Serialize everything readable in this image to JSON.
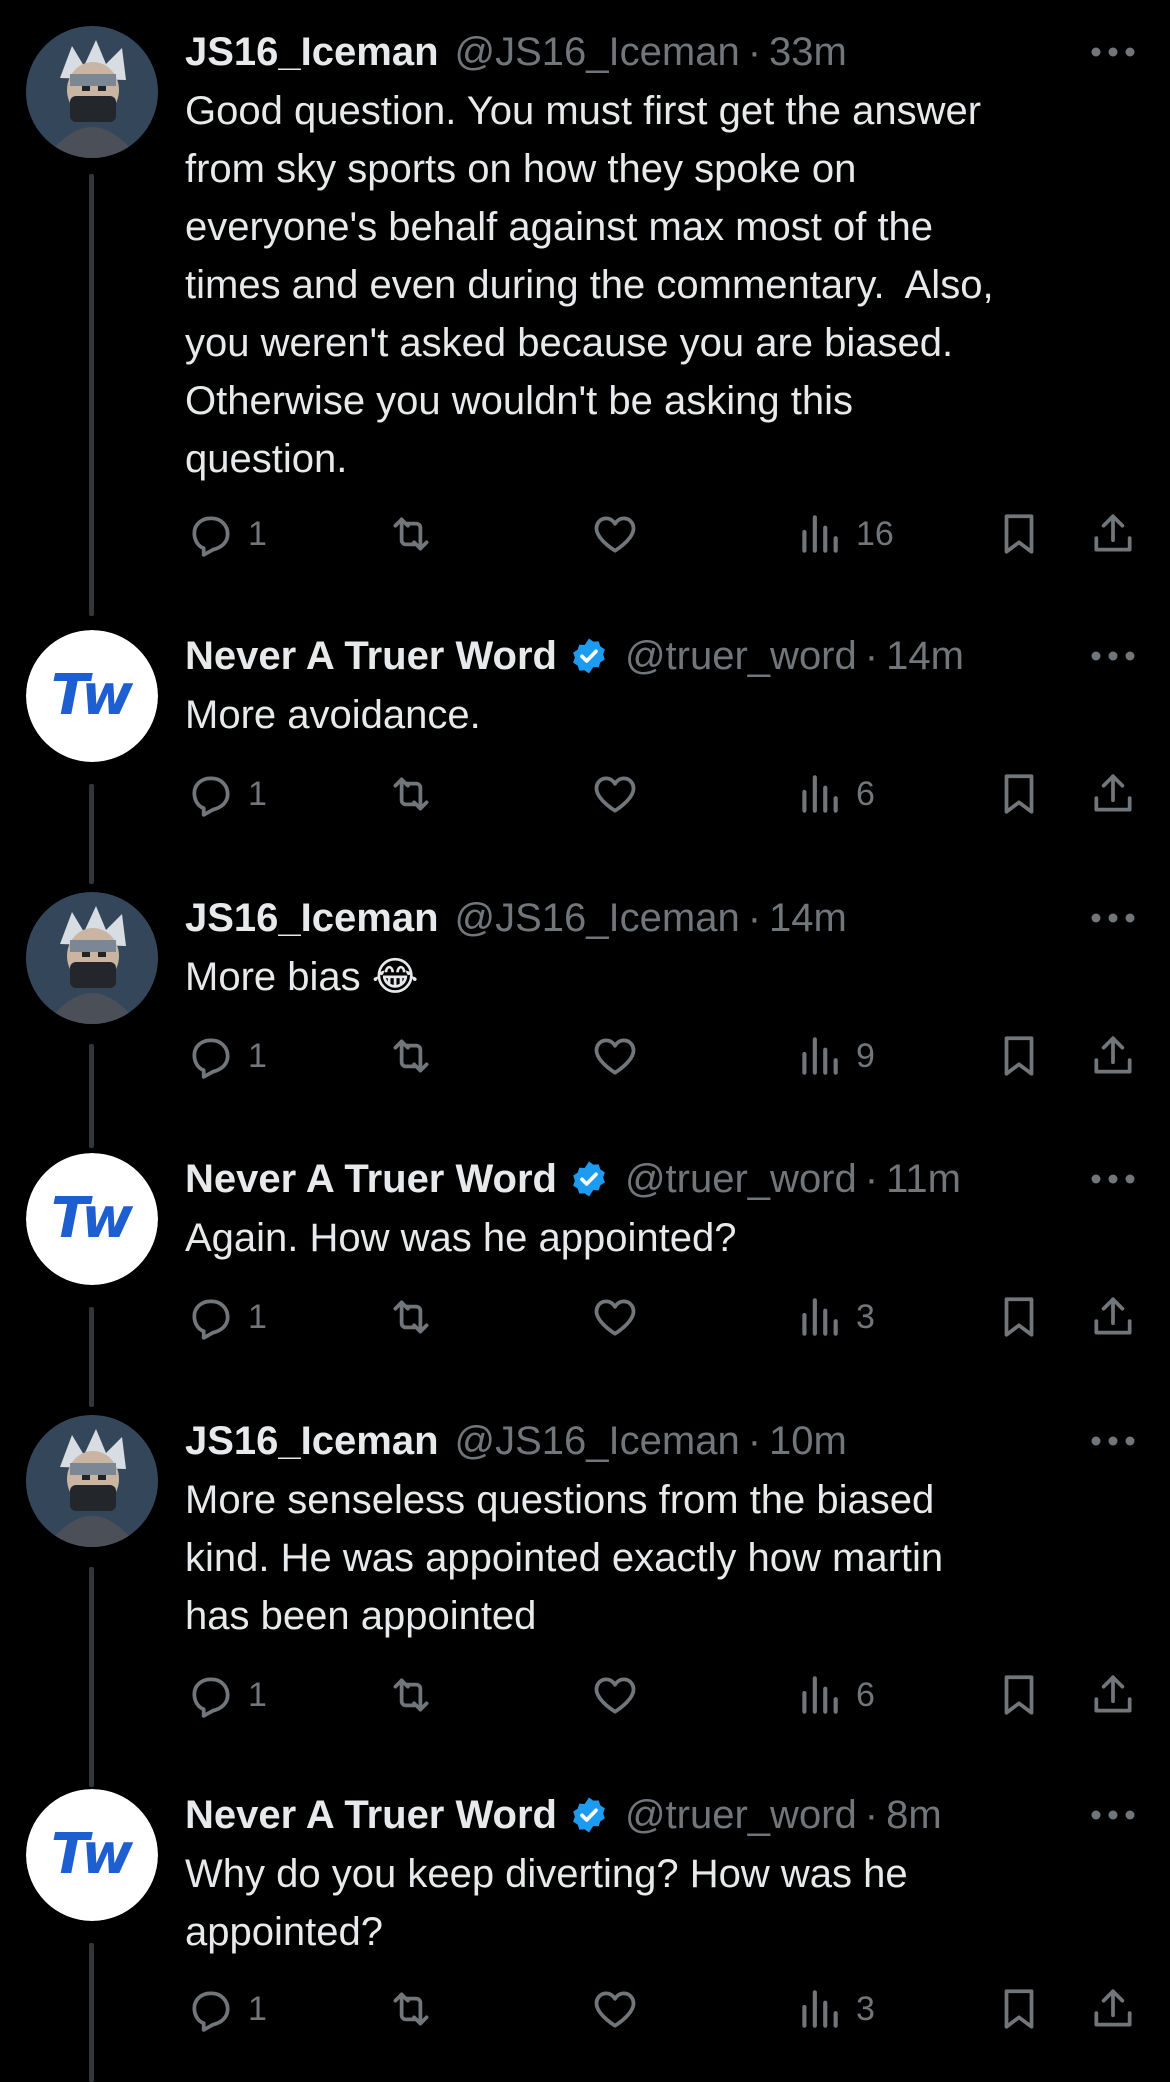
{
  "tweets": [
    {
      "name": "JS16_Iceman",
      "handle": "@JS16_Iceman",
      "time": "33m",
      "verified": false,
      "avatar": "iceman-avatar",
      "text": "Good question. You must first get the answer\nfrom sky sports on how they spoke on\neveryone's behalf against max most of the\ntimes and even during the commentary.  Also,\nyou weren't asked because you are biased.\nOtherwise you wouldn't be asking this\nquestion.",
      "replies": "1",
      "views": "16"
    },
    {
      "name": "Never A Truer Word",
      "handle": "@truer_word",
      "time": "14m",
      "verified": true,
      "avatar": "tw-logo-avatar",
      "text": "More avoidance.",
      "replies": "1",
      "views": "6"
    },
    {
      "name": "JS16_Iceman",
      "handle": "@JS16_Iceman",
      "time": "14m",
      "verified": false,
      "avatar": "iceman-avatar",
      "text": "More bias 😂",
      "replies": "1",
      "views": "9"
    },
    {
      "name": "Never A Truer Word",
      "handle": "@truer_word",
      "time": "11m",
      "verified": true,
      "avatar": "tw-logo-avatar",
      "text": "Again. How was he appointed?",
      "replies": "1",
      "views": "3"
    },
    {
      "name": "JS16_Iceman",
      "handle": "@JS16_Iceman",
      "time": "10m",
      "verified": false,
      "avatar": "iceman-avatar",
      "text": "More senseless questions from the biased\nkind. He was appointed exactly how martin\nhas been appointed",
      "replies": "1",
      "views": "6"
    },
    {
      "name": "Never A Truer Word",
      "handle": "@truer_word",
      "time": "8m",
      "verified": true,
      "avatar": "tw-logo-avatar",
      "text": "Why do you keep diverting? How was he\nappointed?",
      "replies": "1",
      "views": "3"
    }
  ],
  "avatar_text": {
    "tw_logo": "Tw"
  },
  "meta": {
    "dot": "·"
  },
  "colors": {
    "background": "#000000",
    "text": "#e7e9ea",
    "muted": "#71767b",
    "verified": "#1d9bf0",
    "tw_logo": "#1d5fd0",
    "thread_line": "#333639"
  },
  "icons": {
    "reply": "reply-icon",
    "retweet": "retweet-icon",
    "like": "like-icon",
    "views": "views-icon",
    "bookmark": "bookmark-icon",
    "share": "share-icon",
    "more": "more-icon",
    "verified": "verified-badge-icon"
  }
}
